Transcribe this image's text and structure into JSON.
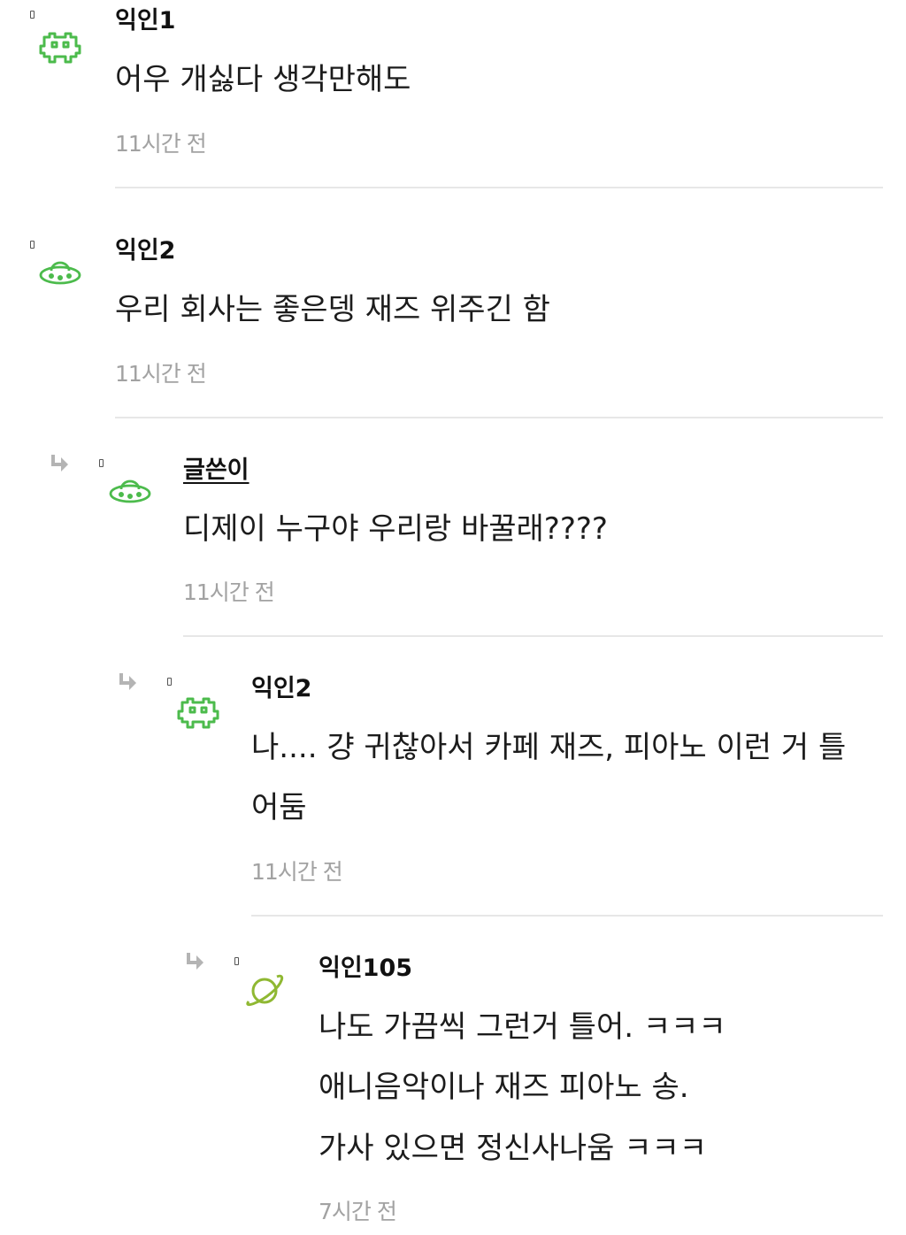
{
  "comments": [
    {
      "author": "익인1",
      "lines": [
        "어우 개싫다 생각만해도"
      ],
      "time": "11시간 전",
      "avatar_icon": "alien-icon",
      "is_reply": false
    },
    {
      "author": "익인2",
      "lines": [
        "우리 회사는 좋은뎅 재즈 위주긴 함"
      ],
      "time": "11시간 전",
      "avatar_icon": "ufo-icon",
      "is_reply": false
    },
    {
      "author": "글쓴이",
      "lines": [
        "디제이 누구야 우리랑 바꿀래????"
      ],
      "time": "11시간 전",
      "avatar_icon": "ufo-icon",
      "is_reply": true
    },
    {
      "author": "익인2",
      "lines": [
        "나.... 걍 귀찮아서 카페 재즈, 피아노 이런 거 틀",
        "어둠"
      ],
      "time": "11시간 전",
      "avatar_icon": "alien-icon",
      "is_reply": true
    },
    {
      "author": "익인105",
      "lines": [
        "나도 가끔씩 그런거 틀어. ㅋㅋㅋ",
        "애니음악이나 재즈 피아노 송.",
        "가사 있으면 정신사나움 ㅋㅋㅋ"
      ],
      "time": "7시간 전",
      "avatar_icon": "planet-icon",
      "is_reply": true
    }
  ],
  "colors": {
    "avatar_green": "#4cbb4c",
    "planet_green": "#8fb832",
    "divider": "#e7e7e7",
    "time_gray": "#a2a2a2",
    "arrow_gray": "#b4b4b4"
  }
}
